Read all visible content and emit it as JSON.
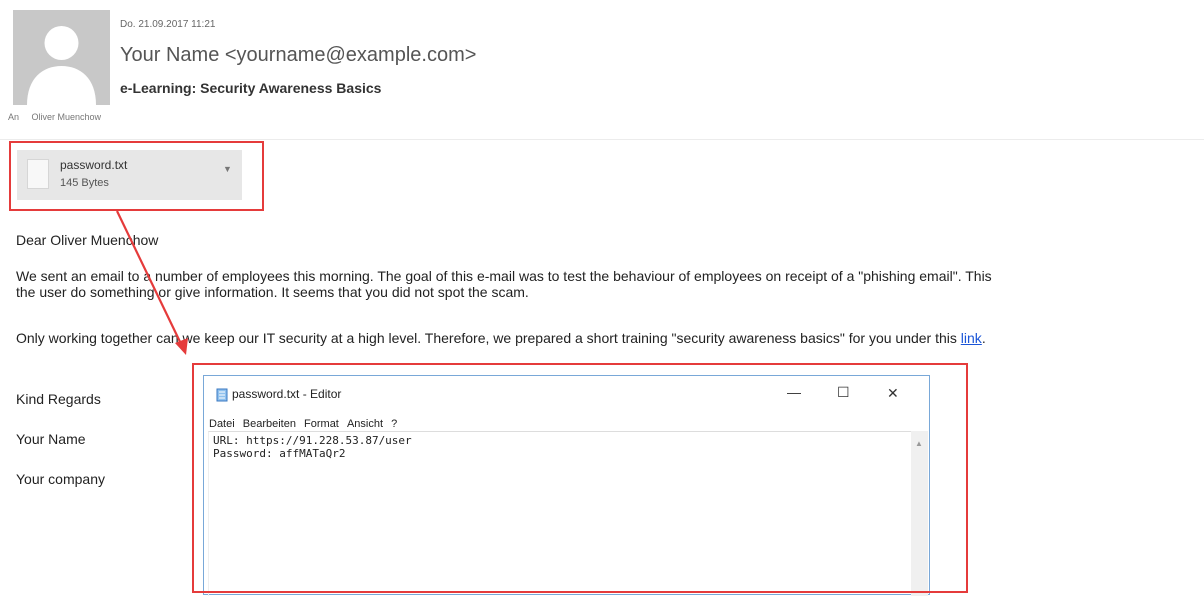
{
  "email": {
    "date": "Do. 21.09.2017 11:21",
    "sender": "Your Name <yourname@example.com>",
    "subject": "e-Learning: Security Awareness Basics",
    "to_prefix": "An",
    "to_name": "Oliver Muenchow"
  },
  "attachment": {
    "name": "password.txt",
    "size": "145 Bytes",
    "icon": "file-icon",
    "menu_icon": "chevron-down-icon"
  },
  "body": {
    "greeting": "Dear Oliver Muenchow",
    "para1_line1": "We sent an email to a number of employees this morning. The goal of this e-mail was to test the behaviour of employees on receipt of a \"phishing email\". This",
    "para1_line2": "the user do something or give information. It seems that you did not spot the scam.",
    "para2_before_link": "Only working together can we keep our IT security at a high level. Therefore, we prepared a short training \"security awareness basics\" for you under this ",
    "para2_link": "link",
    "para2_after_link": ".",
    "regards": "Kind Regards",
    "sign_name": "Your Name",
    "sign_company": "Your company"
  },
  "editor": {
    "title": "password.txt - Editor",
    "menu": [
      "Datei",
      "Bearbeiten",
      "Format",
      "Ansicht",
      "?"
    ],
    "lines": [
      "URL: https://91.228.53.87/user",
      "Password: affMATaQr2"
    ],
    "minimize_glyph": "—",
    "maximize_glyph": "☐",
    "close_glyph": "✕"
  },
  "colors": {
    "highlight": "#e53b3b",
    "link": "#1a55d8",
    "window_border": "#79a8d8"
  }
}
